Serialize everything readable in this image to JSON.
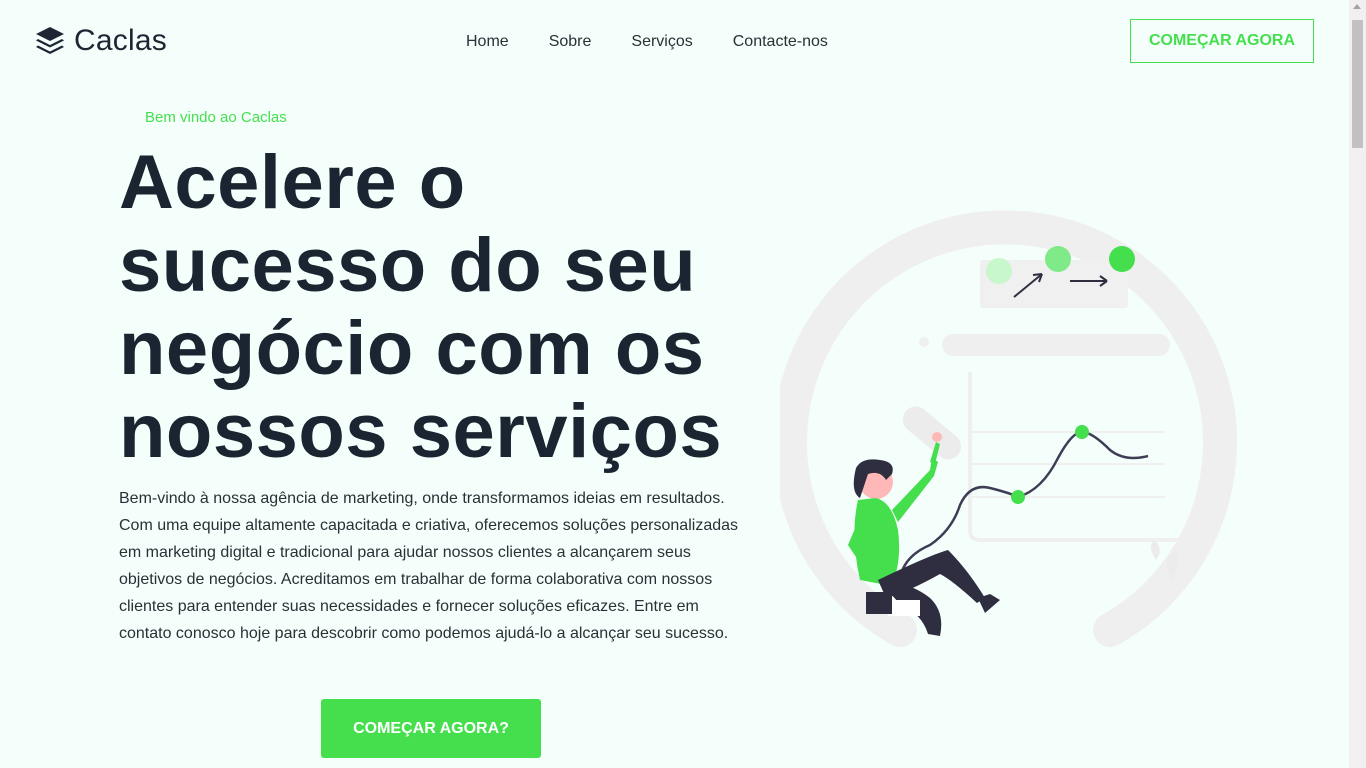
{
  "brand": {
    "name": "Caclas",
    "icon": "layers-icon"
  },
  "nav": {
    "items": [
      "Home",
      "Sobre",
      "Serviços",
      "Contacte-nos"
    ]
  },
  "header": {
    "cta_label": "COMEÇAR AGORA"
  },
  "hero": {
    "eyebrow": "Bem vindo ao Caclas",
    "headline_lines": [
      "Acelere o",
      "sucesso do seu",
      "negócio com os",
      "nossos serviços"
    ],
    "description": "Bem-vindo à nossa agência de marketing, onde transformamos ideias em resultados. Com uma equipe altamente capacitada e criativa, oferecemos soluções personalizadas em marketing digital e tradicional para ajudar nossos clientes a alcançarem seus objetivos de negócios. Acreditamos em trabalhar de forma colaborativa com nossos clientes para entender suas necessidades e fornecer soluções eficazes. Entre em contato conosco hoje para descobrir como podemos ajudá-lo a alcançar seu sucesso.",
    "cta_label": "COMEÇAR AGORA?"
  },
  "colors": {
    "accent": "#45df4e",
    "text": "#1b2431",
    "background": "#f4fffb",
    "illustration_dark": "#2f2e41"
  }
}
